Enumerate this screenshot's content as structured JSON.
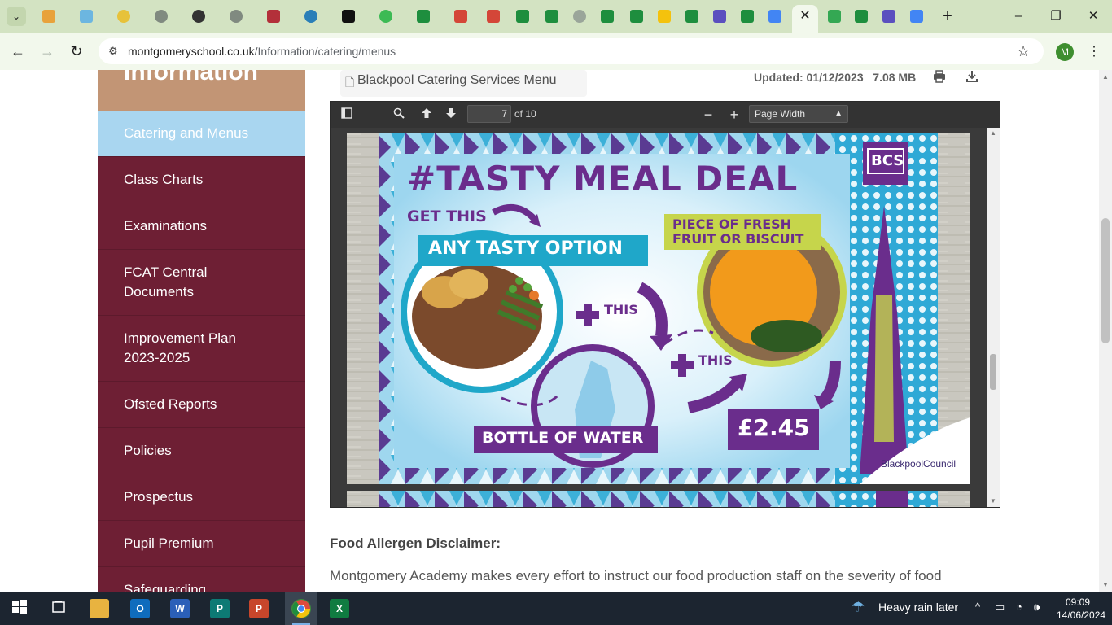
{
  "browser": {
    "url_domain": "montgomeryschool.co.uk",
    "url_path": "/Information/catering/menus",
    "avatar_letter": "M",
    "close_tab_glyph": "✕"
  },
  "sidebar": {
    "heading": "Information",
    "items": [
      {
        "label": "Catering and Menus",
        "active": true
      },
      {
        "label": "Class Charts"
      },
      {
        "label": "Examinations"
      },
      {
        "label": "FCAT Central Documents"
      },
      {
        "label": "Improvement Plan 2023-2025"
      },
      {
        "label": "Ofsted Reports"
      },
      {
        "label": "Policies"
      },
      {
        "label": "Prospectus"
      },
      {
        "label": "Pupil Premium"
      },
      {
        "label": "Safeguarding"
      }
    ]
  },
  "document": {
    "file_name": "Blackpool Catering Services Menu",
    "updated": "Updated: 01/12/2023",
    "size": "7.08 MB"
  },
  "pdf_viewer": {
    "current_page": "7",
    "page_total": "of 10",
    "zoom": "Page Width"
  },
  "poster": {
    "title": "#TASTY MEAL DEAL",
    "get_this": "GET THIS",
    "any_option": "ANY TASTY OPTION",
    "plus_this_1": "THIS",
    "plus_this_2": "THIS",
    "fruit_line1": "PIECE OF FRESH",
    "fruit_line2": "FRUIT OR BISCUIT",
    "water": "BOTTLE OF WATER",
    "price": "£2.45",
    "logo": "BCS",
    "council": "BlackpoolCouncil",
    "colors": {
      "purple": "#6a2d8c",
      "cyan": "#1fa7c9",
      "lime": "#c6d54b",
      "sky": "#cdeaf6"
    }
  },
  "content": {
    "disclaimer_title": "Food Allergen Disclaimer:",
    "disclaimer_text": "Montgomery Academy makes every effort to instruct our food production staff on the severity of food"
  },
  "taskbar": {
    "weather": "Heavy rain later",
    "time": "09:09",
    "date": "14/06/2024"
  }
}
